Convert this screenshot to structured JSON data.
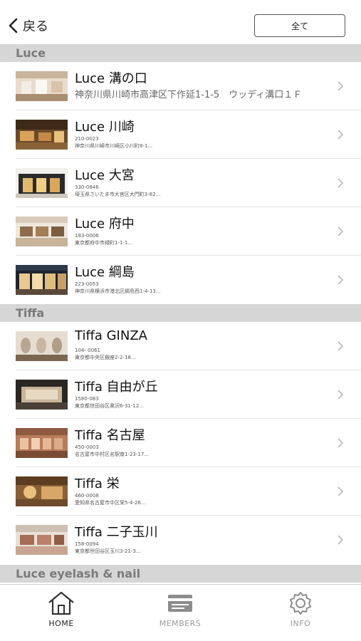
{
  "header": {
    "back_label": "戻る",
    "all_button": "全て"
  },
  "sections": [
    {
      "label": "Luce"
    },
    {
      "label": "Tiffa"
    },
    {
      "label": "Luce eyelash & nail"
    }
  ],
  "stores": [
    {
      "name": "Luce 溝の口",
      "address": "神奈川県川崎市高津区下作延1-1-5　ウッディ溝口１Ｆ"
    },
    {
      "name": "Luce 川崎",
      "zip": "210-0023",
      "address": "神奈川県川崎市川崎区小川町8-1..."
    },
    {
      "name": "Luce 大宮",
      "zip": "330-0846",
      "address": "埼玉県さいたま市大宮区大門町3-82..."
    },
    {
      "name": "Luce 府中",
      "zip": "183-0006",
      "address": "東京都府中市緑町1-1-1..."
    },
    {
      "name": "Luce 綱島",
      "zip": "223-0053",
      "address": "神奈川県横浜市港北区綱島西1-4-13..."
    },
    {
      "name": "Tiffa GINZA",
      "zip": "104- 0061",
      "address": "東京都中央区銀座2-2-18..."
    },
    {
      "name": "Tiffa 自由が丘",
      "zip": "1580-083",
      "address": "東京都世田谷区奥沢6-31-12..."
    },
    {
      "name": "Tiffa 名古屋",
      "zip": "450-0003",
      "address": "名古屋市中村区名駅南1-23-17..."
    },
    {
      "name": "Tiffa 栄",
      "zip": "460-0008",
      "address": "愛知県名古屋市中区栄5-4-26..."
    },
    {
      "name": "Tiffa 二子玉川",
      "zip": "158-0094",
      "address": "東京都世田谷区玉川3-21-3..."
    }
  ],
  "tabs": [
    {
      "label": "HOME",
      "icon": "home-icon"
    },
    {
      "label": "MEMBERS",
      "icon": "members-card-icon"
    },
    {
      "label": "INFO",
      "icon": "gear-icon"
    }
  ]
}
